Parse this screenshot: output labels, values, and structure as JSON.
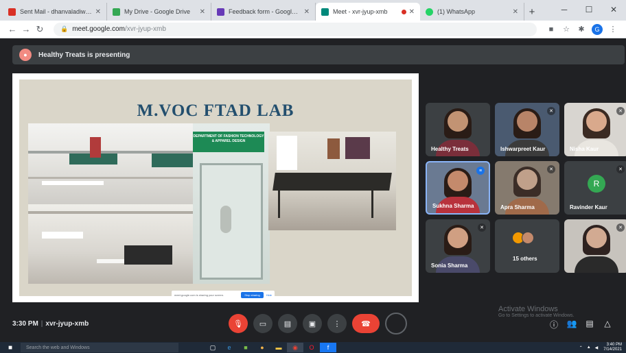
{
  "browser": {
    "tabs": [
      {
        "title": "Sent Mail - dhanvaladiwar@...",
        "color": "#d93025",
        "active": false
      },
      {
        "title": "My Drive - Google Drive",
        "color": "#34a853",
        "active": false
      },
      {
        "title": "Feedback form - Google Fo...",
        "color": "#673ab7",
        "active": false
      },
      {
        "title": "Meet - xvr-jyup-xmb",
        "color": "#00897b",
        "active": true
      },
      {
        "title": "(1) WhatsApp",
        "color": "#25d366",
        "active": false
      }
    ],
    "new_tab": "+",
    "win_min": "─",
    "win_max": "☐",
    "win_close": "✕",
    "url_host": "meet.google.com",
    "url_path": "/xvr-jyup-xmb",
    "back": "←",
    "forward": "→",
    "reload": "↻",
    "profile_letter": "G"
  },
  "meet": {
    "presenter_text": "Healthy Treats is presenting",
    "slide_title": "M.VOC FTAD LAB",
    "dept_sign": "DEPARTMENT OF FASHION TECHNOLOGY & APPAREL DESIGN",
    "share_notice": "meet.google.com is sharing your screen.",
    "share_stop": "Stop sharing",
    "share_hide": "Hide",
    "participants": [
      {
        "name": "Healthy Treats",
        "type": "video"
      },
      {
        "name": "Ishwarpreet Kaur",
        "type": "video"
      },
      {
        "name": "Nisha Kaur",
        "type": "video"
      },
      {
        "name": "Sukhna Sharma",
        "type": "video",
        "speaking": true
      },
      {
        "name": "Apra Sharma",
        "type": "video"
      },
      {
        "name": "Ravinder Kaur",
        "type": "avatar",
        "letter": "R"
      },
      {
        "name": "Sonia Sharma",
        "type": "video"
      },
      {
        "name": "15 others",
        "type": "others"
      },
      {
        "name": "",
        "type": "video"
      }
    ],
    "meeting_time": "3:30 PM",
    "meeting_code": "xvr-jyup-xmb",
    "watermark_title": "Activate Windows",
    "watermark_sub": "Go to Settings to activate Windows."
  },
  "taskbar": {
    "search_placeholder": "Search the web and Windows",
    "time": "3:40 PM",
    "date": "7/14/2021"
  },
  "colors": {
    "meet_bg": "#202124",
    "end_call": "#ea4335",
    "slide_title": "#234f6e"
  }
}
